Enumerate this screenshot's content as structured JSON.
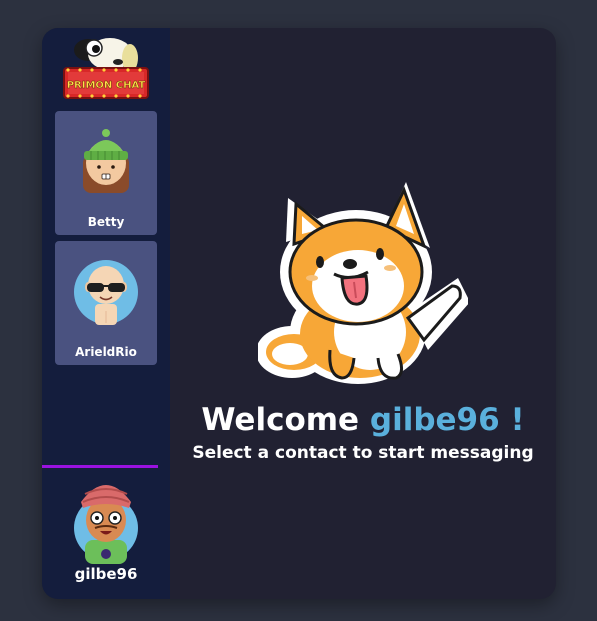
{
  "app": {
    "logo_text": "PRIMON CHAT",
    "accent": "#9a12e0",
    "username_color": "#5ab0dc"
  },
  "contacts": [
    {
      "name": "Betty",
      "avatar": "betty-avatar"
    },
    {
      "name": "ArieldRio",
      "avatar": "arieldrio-avatar"
    }
  ],
  "current_user": {
    "name": "gilbe96",
    "avatar": "gilbe96-avatar"
  },
  "welcome": {
    "prefix": "Welcome ",
    "username": "gilbe96",
    "suffix": " !",
    "subtitle": "Select a contact to start messaging"
  }
}
